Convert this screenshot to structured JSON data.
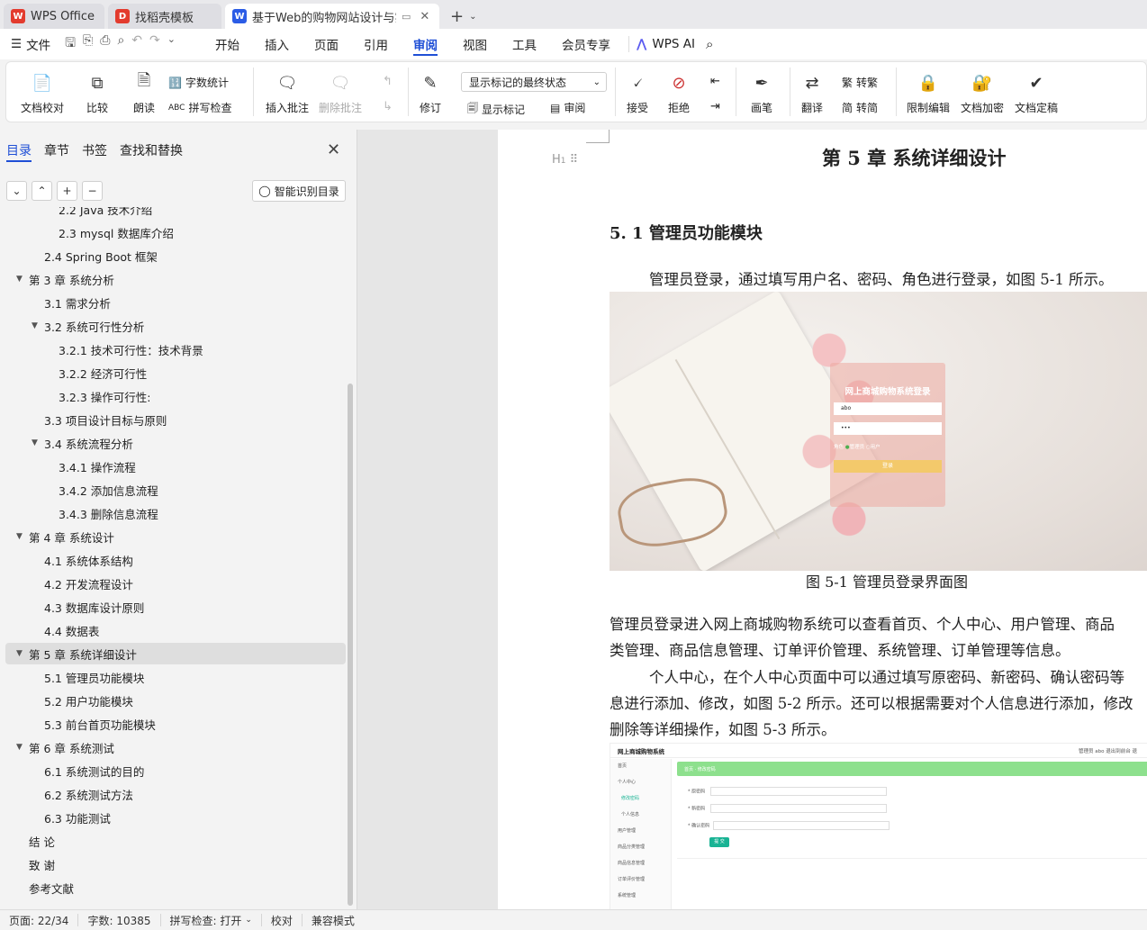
{
  "tabs": [
    {
      "label": "WPS Office",
      "icon": "wps-logo-icon",
      "color": "#e33b2e"
    },
    {
      "label": "找稻壳模板",
      "icon": "docer-icon",
      "color": "#e33b2e"
    },
    {
      "label": "基于Web的购物网站设计与实",
      "icon": "word-doc-icon",
      "color": "#2b5ce6"
    }
  ],
  "menubar": {
    "file": "文件",
    "tabs": [
      "开始",
      "插入",
      "页面",
      "引用",
      "审阅",
      "视图",
      "工具",
      "会员专享"
    ],
    "active_tab": "审阅",
    "ai": "WPS AI"
  },
  "ribbon": {
    "doc_check": "文档校对",
    "compare": "比较",
    "read": "朗读",
    "word_count": "字数统计",
    "spell_check": "拼写检查",
    "insert_comment": "插入批注",
    "delete_comment": "删除批注",
    "track": "修订",
    "markup_state": "显示标记的最终状态",
    "show_markup": "显示标记",
    "review": "审阅",
    "accept": "接受",
    "reject": "拒绝",
    "pen": "画笔",
    "translate": "翻译",
    "to_traditional": "转繁",
    "to_simplified": "转简",
    "restrict": "限制编辑",
    "encrypt": "文档加密",
    "finalize": "文档定稿"
  },
  "nav": {
    "tabs": [
      "目录",
      "章节",
      "书签",
      "查找和替换"
    ],
    "active_tab": "目录",
    "smart_toc": "智能识别目录",
    "items": [
      {
        "label": "2.2  Java 技术介绍",
        "level": 3,
        "arrow": false
      },
      {
        "label": "2.3 mysql 数据库介绍",
        "level": 3,
        "arrow": false
      },
      {
        "label": "2.4 Spring    Boot 框架",
        "level": 2,
        "arrow": false
      },
      {
        "label": "第 3 章  系统分析",
        "level": 1,
        "arrow": true
      },
      {
        "label": "3.1  需求分析",
        "level": 2,
        "arrow": false
      },
      {
        "label": "3.2  系统可行性分析",
        "level": 2,
        "arrow": true
      },
      {
        "label": "3.2.1 技术可行性：技术背景",
        "level": 3,
        "arrow": false
      },
      {
        "label": "3.2.2 经济可行性",
        "level": 3,
        "arrow": false
      },
      {
        "label": "3.2.3 操作可行性:",
        "level": 3,
        "arrow": false
      },
      {
        "label": "3.3  项目设计目标与原则",
        "level": 2,
        "arrow": false
      },
      {
        "label": "3.4 系统流程分析",
        "level": 2,
        "arrow": true
      },
      {
        "label": "3.4.1 操作流程",
        "level": 3,
        "arrow": false
      },
      {
        "label": "3.4.2 添加信息流程",
        "level": 3,
        "arrow": false
      },
      {
        "label": "3.4.3 删除信息流程",
        "level": 3,
        "arrow": false
      },
      {
        "label": "第 4 章  系统设计",
        "level": 1,
        "arrow": true
      },
      {
        "label": "4.1  系统体系结构",
        "level": 2,
        "arrow": false
      },
      {
        "label": "4.2 开发流程设计",
        "level": 2,
        "arrow": false
      },
      {
        "label": "4.3  数据库设计原则",
        "level": 2,
        "arrow": false
      },
      {
        "label": "4.4  数据表",
        "level": 2,
        "arrow": false
      },
      {
        "label": "第 5 章  系统详细设计",
        "level": 1,
        "arrow": true,
        "selected": true
      },
      {
        "label": "5.1 管理员功能模块",
        "level": 2,
        "arrow": false
      },
      {
        "label": "5.2 用户功能模块",
        "level": 2,
        "arrow": false
      },
      {
        "label": "5.3 前台首页功能模块",
        "level": 2,
        "arrow": false
      },
      {
        "label": "第 6 章    系统测试",
        "level": 1,
        "arrow": true
      },
      {
        "label": "6.1 系统测试的目的",
        "level": 2,
        "arrow": false
      },
      {
        "label": "6.2 系统测试方法",
        "level": 2,
        "arrow": false
      },
      {
        "label": "6.3 功能测试",
        "level": 2,
        "arrow": false
      },
      {
        "label": "结  论",
        "level": 1,
        "arrow": false
      },
      {
        "label": "致  谢",
        "level": 1,
        "arrow": false
      },
      {
        "label": "参考文献",
        "level": 1,
        "arrow": false
      }
    ]
  },
  "doc": {
    "heading_marker": "H",
    "chapter_title": "第 5 章  系统详细设计",
    "section_title": "5. 1 管理员功能模块",
    "para1": "管理员登录，通过填写用户名、密码、角色进行登录，如图 5-1 所示。",
    "login_image": {
      "title": "网上商城购物系统登录",
      "username": "abo",
      "password": "•••",
      "role_label": "角色",
      "role_admin": "管理员",
      "role_user": "用户",
      "button": "登录"
    },
    "caption1": "图 5-1 管理员登录界面图",
    "para2_line1": "管理员登录进入网上商城购物系统可以查看首页、个人中心、用户管理、商品",
    "para2_line2": "类管理、商品信息管理、订单评价管理、系统管理、订单管理等信息。",
    "para3_line1": "个人中心，在个人中心页面中可以通过填写原密码、新密码、确认密码等",
    "para3_line2": "息进行添加、修改，如图 5-2 所示。还可以根据需要对个人信息进行添加，修改",
    "para3_line3": "删除等详细操作，如图 5-3 所示。",
    "admin_image": {
      "app_title": "网上商城购物系统",
      "header_right": "管理员 abo   退出到前台   退",
      "menu": [
        "首页",
        "个人中心",
        "修改密码",
        "个人信息",
        "用户管理",
        "商品分类管理",
        "商品信息管理",
        "订单评价管理",
        "系统管理"
      ],
      "breadcrumb": "首页  ·  修改密码",
      "fields": [
        "* 原密码",
        "* 新密码",
        "* 确认密码"
      ],
      "submit": "提 交"
    }
  },
  "status": {
    "page": "页面: 22/34",
    "words": "字数: 10385",
    "spell": "拼写检查: 打开",
    "proof": "校对",
    "compat": "兼容模式"
  },
  "colors": {
    "accent": "#1f4fd6",
    "wps_red": "#e33b2e",
    "green_bar": "#8de08d"
  }
}
